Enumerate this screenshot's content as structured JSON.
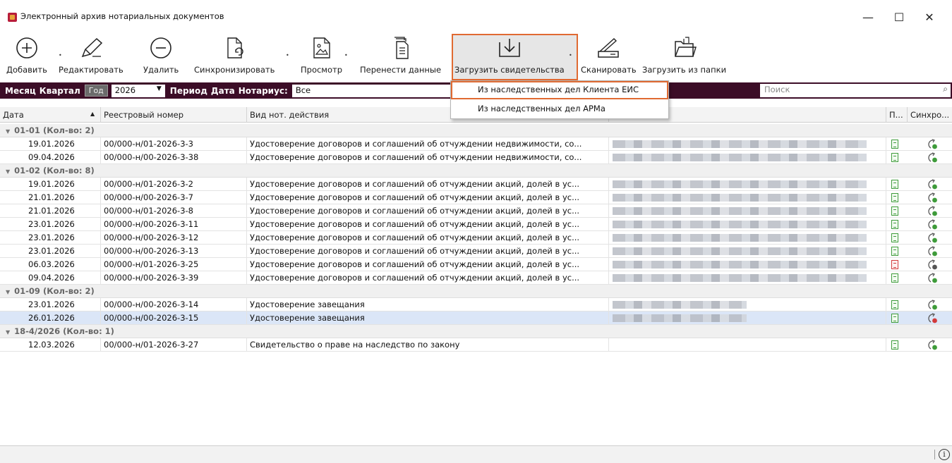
{
  "window": {
    "title": "Электронный архив нотариальных документов",
    "controls": [
      "—",
      "☐",
      "✕"
    ]
  },
  "toolbar": {
    "add": "Добавить",
    "edit": "Редактировать",
    "delete": "Удалить",
    "sync": "Синхронизировать",
    "view": "Просмотр",
    "transfer": "Перенести данные",
    "upload": "Загрузить свидетельства",
    "scan": "Сканировать",
    "load_folder": "Загрузить из папки"
  },
  "filter": {
    "month": "Месяц",
    "quarter": "Квартал",
    "year_btn": "Год",
    "year_value": "2026",
    "period": "Период",
    "date": "Дата",
    "notary_label": "Нотариус:",
    "notary_value": "Все",
    "search_placeholder": "Поиск"
  },
  "dropdown": {
    "item1": "Из наследственных дел Клиента ЕИС",
    "item2": "Из наследственных дел АРМа"
  },
  "columns": {
    "date": "Дата",
    "reg": "Реестровый номер",
    "kind": "Вид нот. действия",
    "p": "П...",
    "sync": "Синхро..."
  },
  "groups": [
    {
      "label": "01-01 (Кол-во: 2)"
    },
    {
      "label": "01-02 (Кол-во: 8)"
    },
    {
      "label": "01-09 (Кол-во: 2)"
    },
    {
      "label": "18-4/2026 (Кол-во: 1)"
    }
  ],
  "rows": [
    {
      "date": "19.01.2026",
      "reg": "00/000-н/01-2026-3-3",
      "kind": "Удостоверение договоров и соглашений об отчуждении недвижимости, со...",
      "doc": "green",
      "sync": "green"
    },
    {
      "date": "09.04.2026",
      "reg": "00/000-н/00-2026-3-38",
      "kind": "Удостоверение договоров и соглашений об отчуждении недвижимости, со...",
      "doc": "green",
      "sync": "green"
    },
    {
      "date": "19.01.2026",
      "reg": "00/000-н/01-2026-3-2",
      "kind": "Удостоверение договоров и соглашений об отчуждении акций, долей в ус...",
      "doc": "green",
      "sync": "green"
    },
    {
      "date": "21.01.2026",
      "reg": "00/000-н/00-2026-3-7",
      "kind": "Удостоверение договоров и соглашений об отчуждении акций, долей в ус...",
      "doc": "green",
      "sync": "green"
    },
    {
      "date": "21.01.2026",
      "reg": "00/000-н/01-2026-3-8",
      "kind": "Удостоверение договоров и соглашений об отчуждении акций, долей в ус...",
      "doc": "green",
      "sync": "green"
    },
    {
      "date": "23.01.2026",
      "reg": "00/000-н/00-2026-3-11",
      "kind": "Удостоверение договоров и соглашений об отчуждении акций, долей в ус...",
      "doc": "green",
      "sync": "green"
    },
    {
      "date": "23.01.2026",
      "reg": "00/000-н/00-2026-3-12",
      "kind": "Удостоверение договоров и соглашений об отчуждении акций, долей в ус...",
      "doc": "green",
      "sync": "green"
    },
    {
      "date": "23.01.2026",
      "reg": "00/000-н/00-2026-3-13",
      "kind": "Удостоверение договоров и соглашений об отчуждении акций, долей в ус...",
      "doc": "green",
      "sync": "green"
    },
    {
      "date": "06.03.2026",
      "reg": "00/000-н/01-2026-3-25",
      "kind": "Удостоверение договоров и соглашений об отчуждении акций, долей в ус...",
      "doc": "red",
      "sync": "gray"
    },
    {
      "date": "09.04.2026",
      "reg": "00/000-н/00-2026-3-39",
      "kind": "Удостоверение договоров и соглашений об отчуждении акций, долей в ус...",
      "doc": "green",
      "sync": "green"
    },
    {
      "date": "23.01.2026",
      "reg": "00/000-н/00-2026-3-14",
      "kind": "Удостоверение завещания",
      "doc": "green",
      "sync": "green"
    },
    {
      "date": "26.01.2026",
      "reg": "00/000-н/00-2026-3-15",
      "kind": "Удостоверение завещания",
      "doc": "green",
      "sync": "red"
    },
    {
      "date": "12.03.2026",
      "reg": "00/000-н/01-2026-3-27",
      "kind": "Свидетельство о праве на наследство по закону",
      "doc": "green",
      "sync": "green"
    }
  ],
  "colors": {
    "accent": "#3c0d27",
    "highlight": "#e06a32",
    "ok": "#3e9b3a",
    "error": "#d23a3a"
  }
}
